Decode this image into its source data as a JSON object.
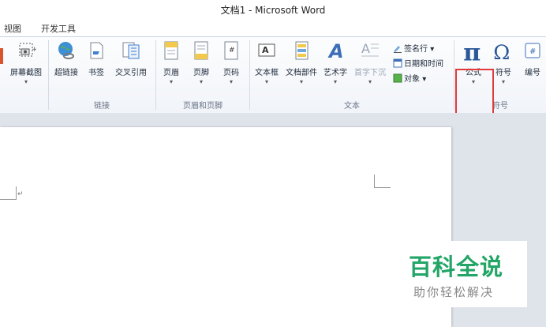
{
  "window": {
    "title": "文档1 - Microsoft Word"
  },
  "tabs": [
    {
      "label": "视图"
    },
    {
      "label": "开发工具"
    }
  ],
  "ribbon": {
    "screenshot": {
      "label": "屏幕截图"
    },
    "links": {
      "hyperlink": "超链接",
      "bookmark": "书签",
      "crossref": "交叉引用",
      "group_label": "链接"
    },
    "header_footer": {
      "header": "页眉",
      "footer": "页脚",
      "page_number": "页码",
      "group_label": "页眉和页脚"
    },
    "text": {
      "textbox": "文本框",
      "quick_parts": "文档部件",
      "wordart": "艺术字",
      "dropcap": "首字下沉",
      "signature_line": "签名行",
      "datetime": "日期和时间",
      "object": "对象",
      "group_label": "文本"
    },
    "symbols": {
      "equation": "公式",
      "symbol": "符号",
      "numbering": "编号",
      "group_label": "符号"
    },
    "dropdown_glyph": "▾"
  },
  "document": {
    "paragraph_mark": "↵"
  },
  "watermark": {
    "title": "百科全说",
    "subtitle": "助你轻松解决"
  },
  "colors": {
    "accent": "#2b5797",
    "highlight": "#e23a3a",
    "watermark": "#22a566"
  }
}
